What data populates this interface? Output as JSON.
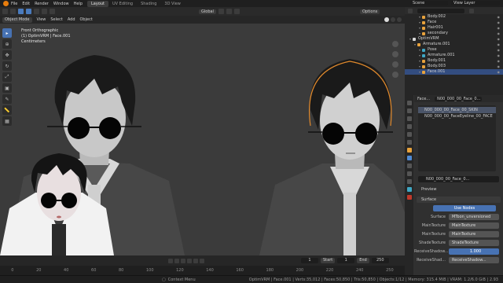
{
  "app": {
    "menu": [
      "File",
      "Edit",
      "Render",
      "Window",
      "Help"
    ],
    "workspaces": [
      "Layout",
      "UV Editing",
      "Shading",
      "3D View"
    ],
    "active_workspace": "Layout",
    "scene_label": "Scene",
    "view_layer_label": "View Layer"
  },
  "toolbar": {
    "transform_orientation": "Global",
    "options_label": "Options"
  },
  "mode_header": {
    "mode": "Object Mode",
    "menu": [
      "View",
      "Select",
      "Add",
      "Object"
    ]
  },
  "viewport": {
    "view_name": "Front Orthographic",
    "object_info": "(1) OptimVRM | Face.001",
    "units": "Centimeters"
  },
  "outliner": {
    "rows": [
      {
        "name": "Body.002",
        "indent": 3,
        "selected": false,
        "color": "#e8a23c"
      },
      {
        "name": "Face",
        "indent": 3,
        "selected": false,
        "color": "#e8a23c"
      },
      {
        "name": "Hair001",
        "indent": 3,
        "selected": false,
        "color": "#e8a23c"
      },
      {
        "name": "secondary",
        "indent": 3,
        "selected": false,
        "color": "#e8a23c"
      },
      {
        "name": "OptimVRM",
        "indent": 1,
        "selected": false,
        "color": "#d9d9d9"
      },
      {
        "name": "Armature.001",
        "indent": 2,
        "selected": false,
        "color": "#e8a23c"
      },
      {
        "name": "Pose",
        "indent": 3,
        "selected": false,
        "color": "#3fa7c4"
      },
      {
        "name": "Armature.001",
        "indent": 3,
        "selected": false,
        "color": "#3fa7c4"
      },
      {
        "name": "Body.001",
        "indent": 3,
        "selected": false,
        "color": "#e8a23c"
      },
      {
        "name": "Body.003",
        "indent": 3,
        "selected": false,
        "color": "#e8a23c"
      },
      {
        "name": "Face.001",
        "indent": 3,
        "selected": true,
        "color": "#e8a23c"
      }
    ]
  },
  "properties": {
    "object_field": "Face...",
    "material_field": "N00_000_00_Face_0...",
    "slots": [
      {
        "name": "N00_000_00_Face_00_SKIN",
        "selected": true
      },
      {
        "name": "N00_000_00_FaceEyeline_00_FACE",
        "selected": false
      }
    ],
    "material_name": "N00_000_00_Face_0...",
    "preview_label": "Preview",
    "surface_label": "Surface",
    "use_nodes_label": "Use Nodes",
    "rows": [
      {
        "label": "Surface",
        "value": "MToon_unversioned",
        "kind": "text"
      },
      {
        "label": "MainTexture",
        "value": "MainTexture",
        "kind": "text"
      },
      {
        "label": "MainTexture",
        "value": "MainTexture",
        "kind": "text"
      },
      {
        "label": "ShadeTexture",
        "value": "ShadeTexture",
        "kind": "text"
      },
      {
        "label": "ReceiveShadow...",
        "value": "1.000",
        "kind": "num"
      },
      {
        "label": "ReceiveShad...",
        "value": "ReceiveShadow...",
        "kind": "text"
      }
    ]
  },
  "timeline": {
    "current_frame": "1",
    "start_label": "Start",
    "start": "1",
    "end_label": "End",
    "end": "250",
    "ruler": [
      "0",
      "20",
      "40",
      "60",
      "80",
      "100",
      "120",
      "140",
      "160",
      "180",
      "200",
      "220",
      "240",
      "250"
    ]
  },
  "statusbar": {
    "context": "Context Menu",
    "stats": "OptimVRM | Face.001 | Verts:35,012 | Faces:50,850 | Tris:50,850 | Objects:1/12 | Memory: 315.4 MiB | VRAM: 1.2/6.0 GiB | 2.93"
  }
}
